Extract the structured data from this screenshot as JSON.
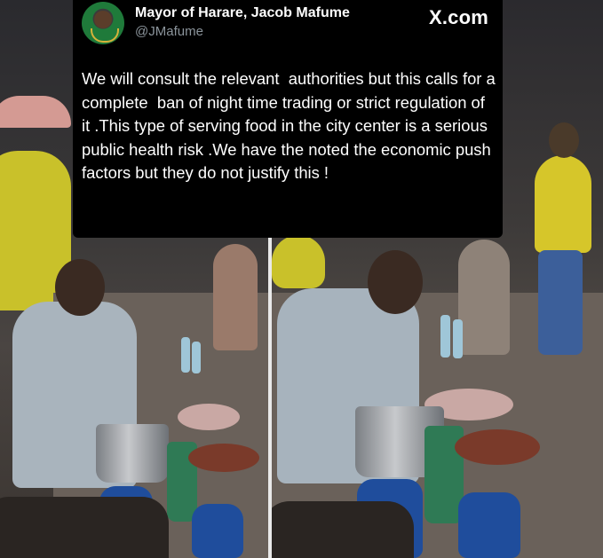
{
  "tweet": {
    "author_name": "Mayor of Harare, Jacob Mafume",
    "author_handle": "@JMafume",
    "platform": "X.com",
    "text": "We will consult the relevant  authorities but this calls for a complete  ban of night time trading or strict regulation of it .This type of serving food in the city center is a serious public health risk .We have the noted the economic push factors but they do not justify this !"
  },
  "icons": {
    "avatar": "profile-photo-icon",
    "platform_logo": "x-logo-icon"
  },
  "colors": {
    "tweet_background": "#000000",
    "tweet_text": "#ffffff",
    "handle_text": "#8b949b"
  }
}
